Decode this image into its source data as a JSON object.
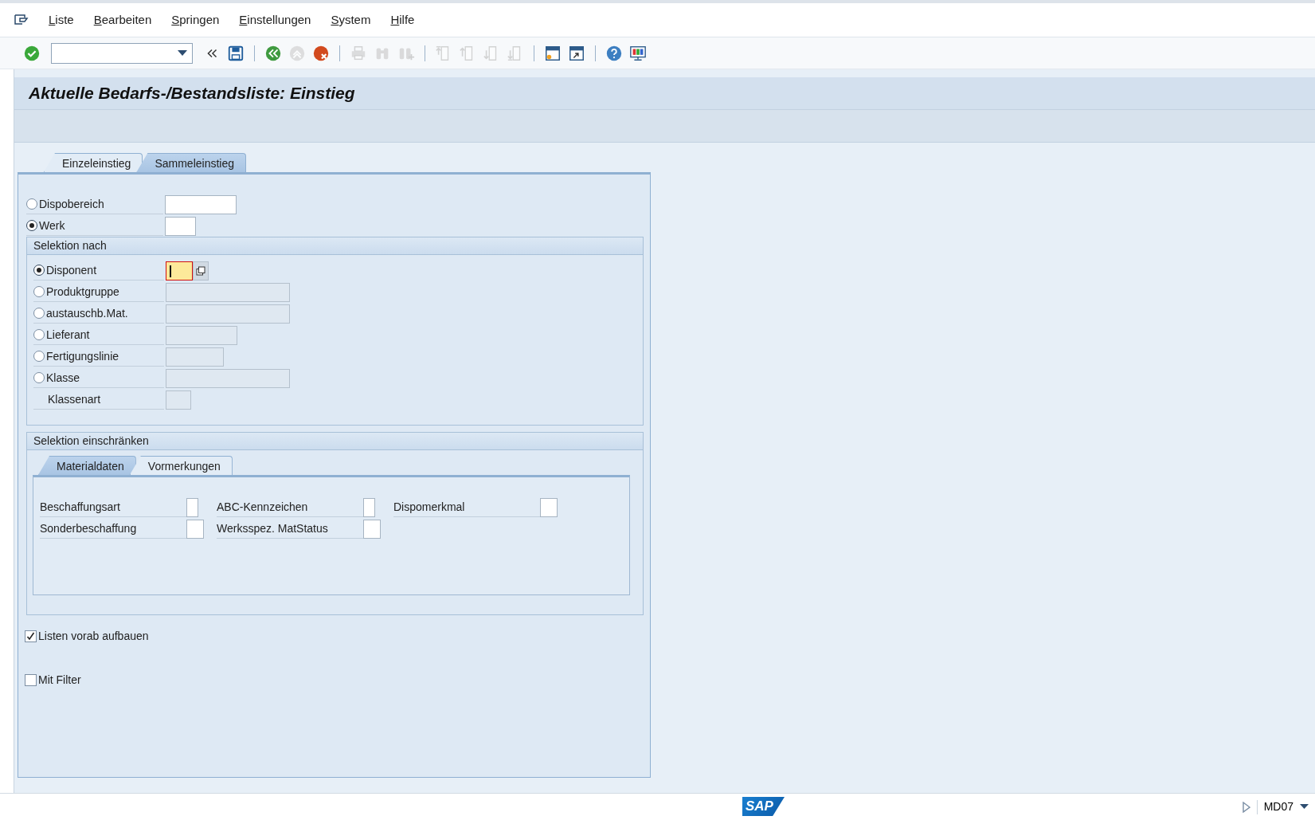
{
  "menu": [
    {
      "label": "Liste"
    },
    {
      "label": "Bearbeiten"
    },
    {
      "label": "Springen"
    },
    {
      "label": "Einstellungen"
    },
    {
      "label": "System"
    },
    {
      "label": "Hilfe"
    }
  ],
  "toolbar": [
    {
      "kind": "check",
      "disabled": false
    },
    {
      "kind": "command"
    },
    {
      "kind": "collapse",
      "disabled": false
    },
    {
      "kind": "save",
      "disabled": false
    },
    {
      "kind": "separator"
    },
    {
      "kind": "back",
      "disabled": false
    },
    {
      "kind": "exit",
      "disabled": true
    },
    {
      "kind": "cancel",
      "disabled": false
    },
    {
      "kind": "separator"
    },
    {
      "kind": "print",
      "disabled": true
    },
    {
      "kind": "find",
      "disabled": true
    },
    {
      "kind": "find-next",
      "disabled": true
    },
    {
      "kind": "separator"
    },
    {
      "kind": "first-page",
      "disabled": true
    },
    {
      "kind": "prev-page",
      "disabled": true
    },
    {
      "kind": "next-page",
      "disabled": true
    },
    {
      "kind": "last-page",
      "disabled": true
    },
    {
      "kind": "separator"
    },
    {
      "kind": "new-session",
      "disabled": false
    },
    {
      "kind": "shortcut",
      "disabled": false
    },
    {
      "kind": "separator"
    },
    {
      "kind": "help",
      "disabled": false
    },
    {
      "kind": "layout",
      "disabled": false
    }
  ],
  "title": "Aktuelle Bedarfs-/Bestandsliste: Einstieg",
  "tabs": [
    {
      "label": "Einzeleinstieg",
      "selected": false
    },
    {
      "label": "Sammeleinstieg",
      "selected": true
    }
  ],
  "scope": [
    {
      "label": "Dispobereich",
      "selected": false,
      "disabled": false
    },
    {
      "label": "Werk",
      "selected": true,
      "disabled": false
    }
  ],
  "selection": {
    "title": "Selektion nach",
    "rows": [
      {
        "kind": "radio",
        "label": "Disponent",
        "selected": true,
        "disabled": false,
        "focused": true
      },
      {
        "kind": "radio",
        "label": "Produktgruppe",
        "selected": false,
        "disabled": true,
        "focused": false
      },
      {
        "kind": "radio",
        "label": "austauschb.Mat.",
        "selected": false,
        "disabled": true,
        "focused": false
      },
      {
        "kind": "radio",
        "label": "Lieferant",
        "selected": false,
        "disabled": true,
        "focused": false
      },
      {
        "kind": "radio",
        "label": "Fertigungslinie",
        "selected": false,
        "disabled": true,
        "focused": false
      },
      {
        "kind": "radio",
        "label": "Klasse",
        "selected": false,
        "disabled": true,
        "focused": false
      },
      {
        "kind": "label",
        "label": "Klassenart",
        "disabled": true,
        "focused": false
      }
    ]
  },
  "restrict": {
    "title": "Selektion einschränken",
    "tabs": [
      {
        "label": "Materialdaten",
        "selected": true
      },
      {
        "label": "Vormerkungen",
        "selected": false
      }
    ],
    "columns": [
      [
        {
          "label": "Beschaffungsart"
        },
        {
          "label": "Sonderbeschaffung"
        }
      ],
      [
        {
          "label": "ABC-Kennzeichen"
        },
        {
          "label": "Werksspez. MatStatus"
        }
      ],
      [
        {
          "label": "Dispomerkmal"
        }
      ]
    ]
  },
  "options": [
    {
      "label": "Listen vorab aufbauen",
      "checked": true
    },
    {
      "label": "Mit Filter",
      "checked": false
    }
  ],
  "status_bar": {
    "logo": "SAP",
    "transaction": "MD07"
  }
}
